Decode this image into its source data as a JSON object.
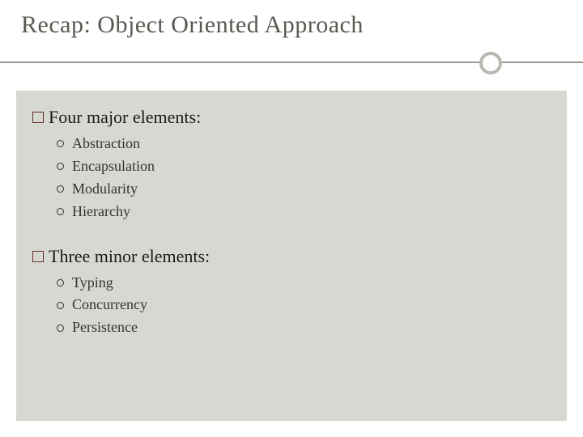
{
  "title": "Recap:  Object Oriented Approach",
  "sections": [
    {
      "heading": "Four major elements:",
      "items": [
        "Abstraction",
        "Encapsulation",
        "Modularity",
        " Hierarchy"
      ]
    },
    {
      "heading": "Three minor elements:",
      "items": [
        "Typing",
        "Concurrency",
        "Persistence"
      ]
    }
  ]
}
